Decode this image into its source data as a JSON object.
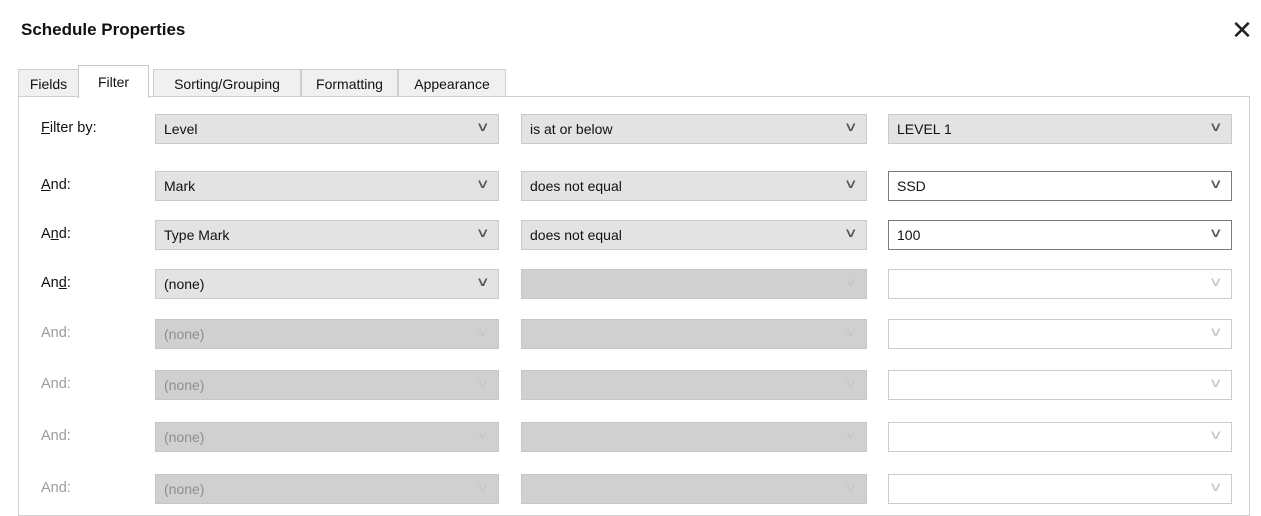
{
  "window": {
    "title": "Schedule Properties",
    "close_icon": "close-icon"
  },
  "tabs": [
    {
      "label": "Fields",
      "active": false
    },
    {
      "label": "Filter",
      "active": true
    },
    {
      "label": "Sorting/Grouping",
      "active": false
    },
    {
      "label": "Formatting",
      "active": false
    },
    {
      "label": "Appearance",
      "active": false
    }
  ],
  "filters": [
    {
      "label_pre": "",
      "label_u": "F",
      "label_post": "ilter by:",
      "enabled": true,
      "field": "Level",
      "condition": "is at or below",
      "value": "LEVEL 1"
    },
    {
      "label_pre": "",
      "label_u": "A",
      "label_post": "nd:",
      "enabled": true,
      "field": "Mark",
      "condition": "does not equal",
      "value": "SSD"
    },
    {
      "label_pre": "A",
      "label_u": "n",
      "label_post": "d:",
      "enabled": true,
      "field": "Type Mark",
      "condition": "does not equal",
      "value": "100"
    },
    {
      "label_pre": "An",
      "label_u": "d",
      "label_post": ":",
      "enabled": true,
      "field": "(none)",
      "condition": "",
      "value": ""
    },
    {
      "label_pre": "And:",
      "label_u": "",
      "label_post": "",
      "enabled": false,
      "field": "(none)",
      "condition": "",
      "value": ""
    },
    {
      "label_pre": "And:",
      "label_u": "",
      "label_post": "",
      "enabled": false,
      "field": "(none)",
      "condition": "",
      "value": ""
    },
    {
      "label_pre": "And:",
      "label_u": "",
      "label_post": "",
      "enabled": false,
      "field": "(none)",
      "condition": "",
      "value": ""
    },
    {
      "label_pre": "And:",
      "label_u": "",
      "label_post": "",
      "enabled": false,
      "field": "(none)",
      "condition": "",
      "value": ""
    }
  ]
}
